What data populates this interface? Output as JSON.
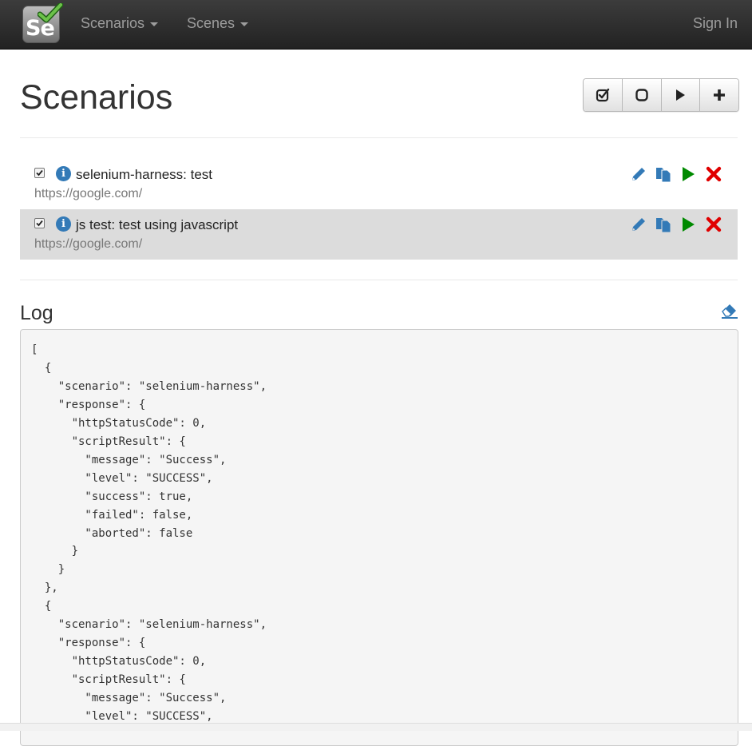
{
  "navbar": {
    "logo_text": "Se",
    "menu": [
      {
        "label": "Scenarios"
      },
      {
        "label": "Scenes"
      }
    ],
    "sign_in": "Sign In"
  },
  "page": {
    "title": "Scenarios",
    "toolbar_icons": [
      "select-all-icon",
      "stop-icon",
      "play-icon",
      "plus-icon"
    ]
  },
  "scenarios": [
    {
      "checked": true,
      "name": "selenium-harness: test",
      "url": "https://google.com/",
      "selected": false
    },
    {
      "checked": true,
      "name": "js test: test using javascript",
      "url": "https://google.com/",
      "selected": true
    }
  ],
  "scenario_action_icons": [
    "edit-icon",
    "copy-icon",
    "run-icon",
    "delete-icon"
  ],
  "colors": {
    "accent": "#337ab7",
    "run": "#008a00",
    "delete": "#e00000"
  },
  "log": {
    "title": "Log",
    "content": "[\n  {\n    \"scenario\": \"selenium-harness\",\n    \"response\": {\n      \"httpStatusCode\": 0,\n      \"scriptResult\": {\n        \"message\": \"Success\",\n        \"level\": \"SUCCESS\",\n        \"success\": true,\n        \"failed\": false,\n        \"aborted\": false\n      }\n    }\n  },\n  {\n    \"scenario\": \"selenium-harness\",\n    \"response\": {\n      \"httpStatusCode\": 0,\n      \"scriptResult\": {\n        \"message\": \"Success\",\n        \"level\": \"SUCCESS\","
  }
}
